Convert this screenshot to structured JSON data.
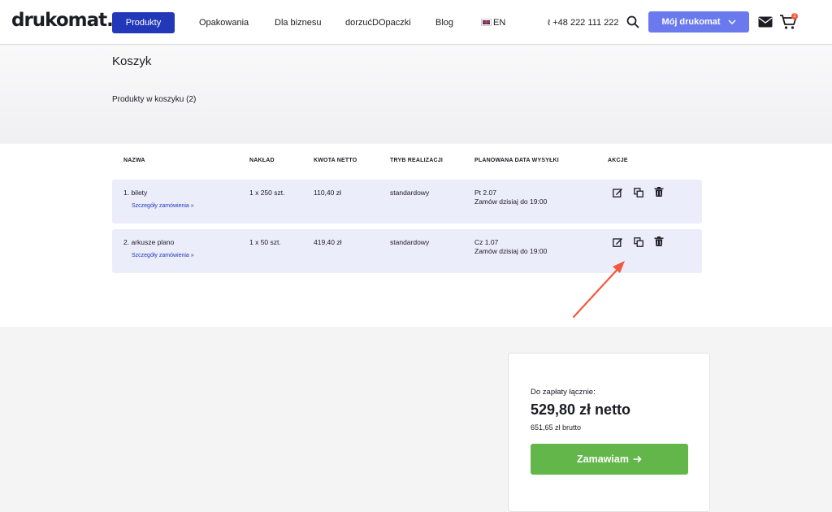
{
  "header": {
    "logo": "drukomat.",
    "nav": {
      "produkty": "Produkty",
      "opakowania": "Opakowania",
      "dla_biznesu": "Dla biznesu",
      "dorzuc": "dorzućDOpaczki",
      "blog": "Blog",
      "lang": "EN"
    },
    "phone": "+48 222 111 222",
    "account_button": "Mój drukomat",
    "cart_count": "2"
  },
  "page": {
    "title": "Koszyk",
    "subtitle": "Produkty w koszyku (2)"
  },
  "table": {
    "headers": {
      "name": "NAZWA",
      "qty": "NAKŁAD",
      "net": "KWOTA NETTO",
      "mode": "TRYB REALIZACJI",
      "ship": "PLANOWANA DATA WYSYŁKI",
      "actions": "AKCJE"
    },
    "rows": [
      {
        "name": "1. bilety",
        "details": "Szczegóły zamówienia",
        "qty": "1 x 250 szt.",
        "net": "110,40 zł",
        "mode": "standardowy",
        "ship_date": "Pt 2.07",
        "ship_note": "Zamów dzisiaj do 19:00"
      },
      {
        "name": "2. arkusze plano",
        "details": "Szczegóły zamówienia",
        "qty": "1 x 50 szt.",
        "net": "419,40 zł",
        "mode": "standardowy",
        "ship_date": "Cz 1.07",
        "ship_note": "Zamów dzisiaj do 19:00"
      }
    ]
  },
  "summary": {
    "label": "Do zapłaty łącznie:",
    "total": "529,80 zł netto",
    "brutto": "651,65 zł brutto",
    "order_button": "Zamawiam"
  },
  "colors": {
    "primary": "#2238b8",
    "accent": "#6b79ee",
    "row_bg": "#ebedfb",
    "order_green": "#62b64a",
    "annotation_arrow": "#f15a3a"
  }
}
